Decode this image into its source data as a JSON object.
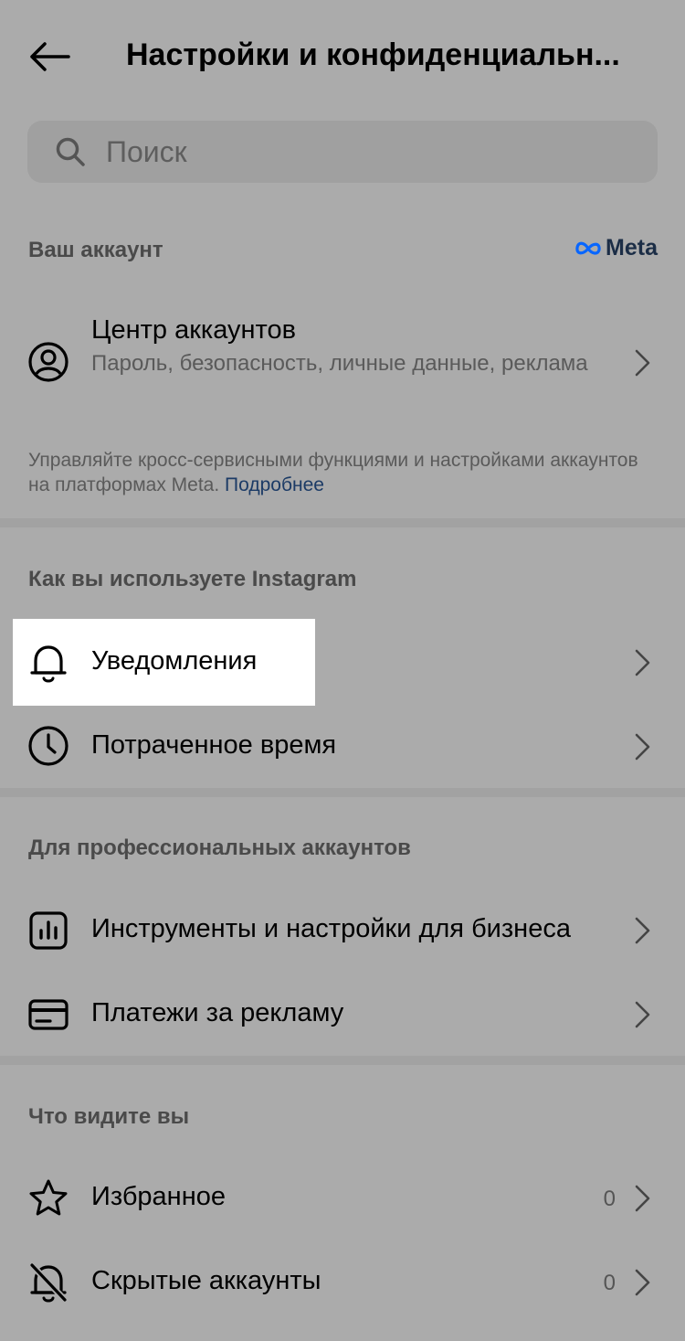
{
  "header": {
    "title": "Настройки и конфиденциальн..."
  },
  "search": {
    "placeholder": "Поиск"
  },
  "section_account": {
    "heading": "Ваш аккаунт",
    "brand": "Meta",
    "accounts_center": {
      "title": "Центр аккаунтов",
      "subtitle": "Пароль, безопасность, личные данные, реклама"
    },
    "note_text": "Управляйте кросс-сервисными функциями и настройками аккаунтов на платформах Meta. ",
    "note_link": "Подробнее"
  },
  "section_usage": {
    "heading": "Как вы используете Instagram",
    "items": [
      {
        "label": "Уведомления",
        "icon": "bell-icon"
      },
      {
        "label": "Потраченное время",
        "icon": "clock-icon"
      }
    ]
  },
  "section_pro": {
    "heading": "Для профессиональных аккаунтов",
    "items": [
      {
        "label": "Инструменты и настройки для бизнеса",
        "icon": "chart-icon"
      },
      {
        "label": "Платежи за рекламу",
        "icon": "card-icon"
      }
    ]
  },
  "section_see": {
    "heading": "Что видите вы",
    "items": [
      {
        "label": "Избранное",
        "count": "0",
        "icon": "star-icon"
      },
      {
        "label": "Скрытые аккаунты",
        "count": "0",
        "icon": "muted-bell-icon"
      }
    ]
  }
}
